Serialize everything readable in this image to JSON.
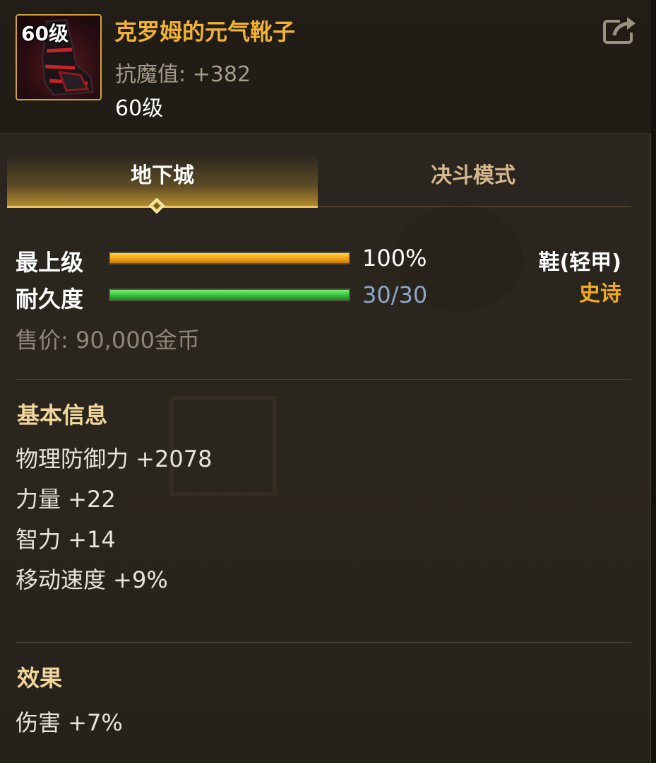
{
  "item": {
    "icon_level": "60级",
    "name": "克罗姆的元气靴子",
    "magic_resistance": "抗魔值: +382",
    "level": "60级",
    "share_icon": "share-icon"
  },
  "tabs": [
    {
      "label": "地下城",
      "active": true
    },
    {
      "label": "决斗模式",
      "active": false
    }
  ],
  "stats": {
    "grade_label": "最上级",
    "grade_value": "100%",
    "grade_fraction": 1.0,
    "durability_label": "耐久度",
    "durability_value": "30/30",
    "durability_fraction": 1.0,
    "equip_type": "鞋(轻甲)",
    "rarity": "史诗",
    "price": "售价: 90,000金币"
  },
  "basic_info": {
    "title": "基本信息",
    "lines": [
      "物理防御力 +2078",
      "力量 +22",
      "智力 +14",
      "移动速度 +9%"
    ]
  },
  "effect": {
    "title": "效果",
    "lines": [
      "伤害 +7%"
    ]
  },
  "colors": {
    "item_name": "#f2b233",
    "rarity": "#f2a91e",
    "durability_value": "#8fa7c7",
    "tab_accent": "#e8c162"
  }
}
